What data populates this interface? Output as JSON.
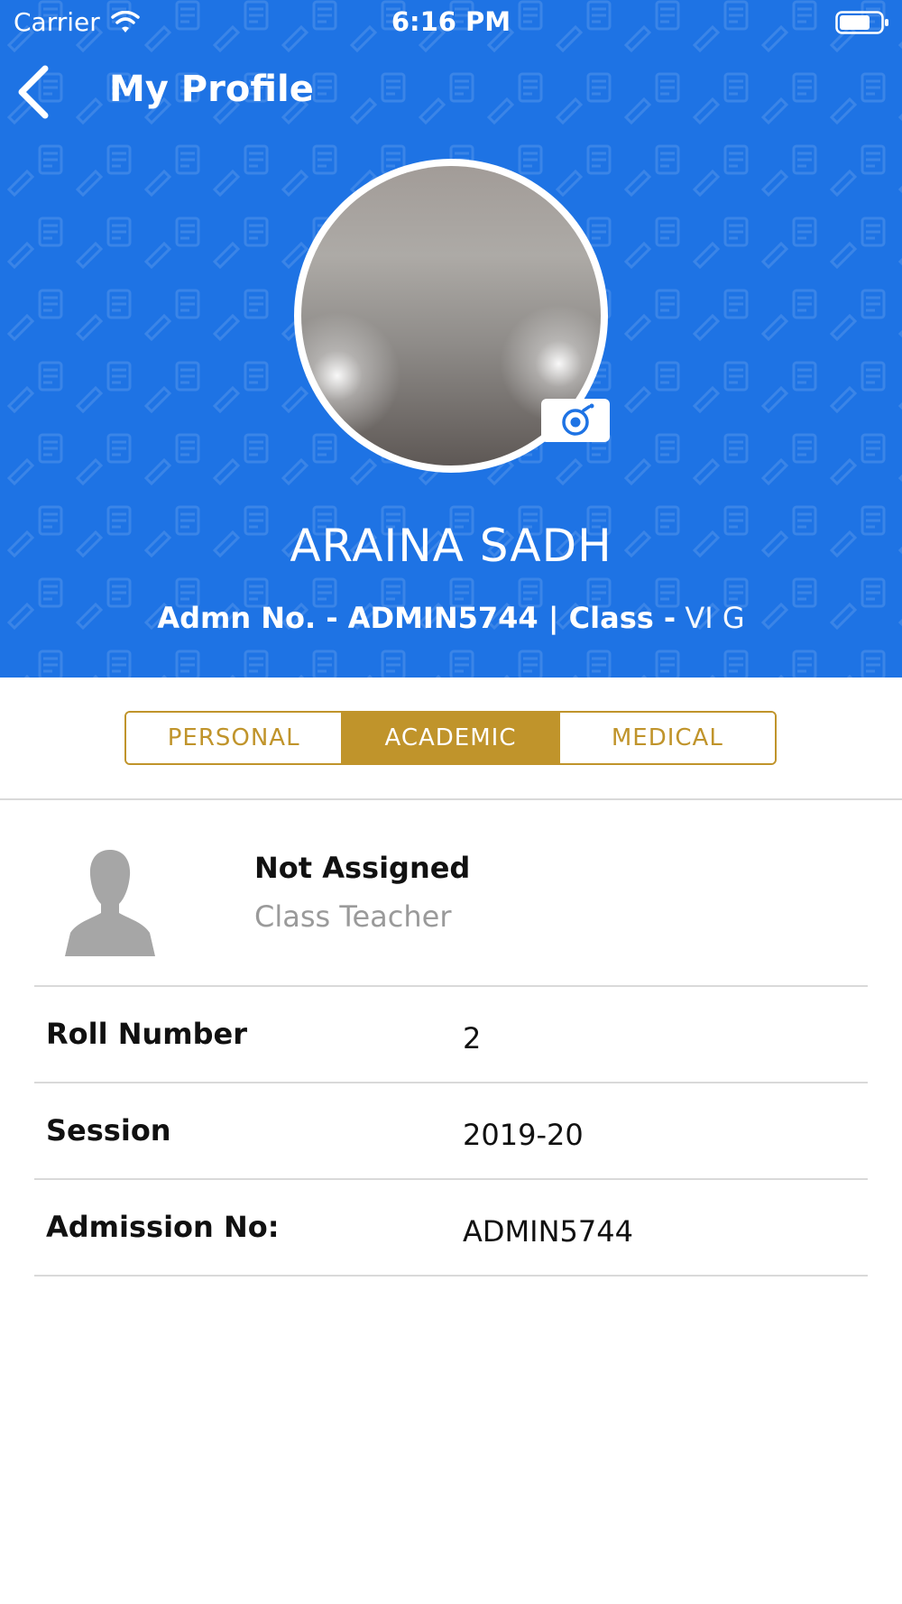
{
  "status_bar": {
    "carrier": "Carrier",
    "time": "6:16 PM"
  },
  "nav": {
    "title": "My Profile"
  },
  "profile": {
    "name": "ARAINA SADH",
    "admn_label": "Admn No. - ADMIN5744 | Class -",
    "class_value": "VI G"
  },
  "tabs": [
    {
      "label": "PERSONAL",
      "active": false
    },
    {
      "label": "ACADEMIC",
      "active": true
    },
    {
      "label": "MEDICAL",
      "active": false
    }
  ],
  "teacher": {
    "name": "Not Assigned",
    "role": "Class Teacher"
  },
  "rows": [
    {
      "label": "Roll Number",
      "value": "2"
    },
    {
      "label": "Session",
      "value": "2019-20"
    },
    {
      "label": "Admission No:",
      "value": "ADMIN5744"
    }
  ],
  "colors": {
    "header_blue": "#1e73e4",
    "accent_gold": "#c0942b",
    "divider": "#d9d9d9",
    "muted_text": "#9a9a9a"
  }
}
